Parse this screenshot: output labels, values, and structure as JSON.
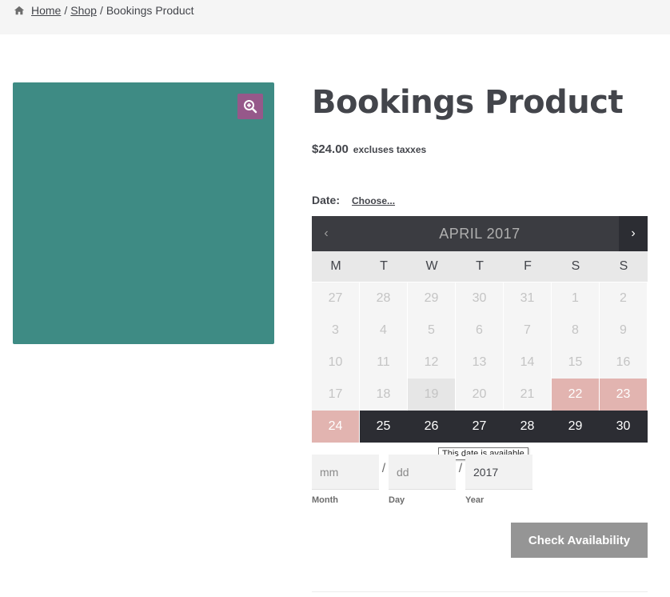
{
  "breadcrumb": {
    "home": "Home",
    "shop": "Shop",
    "separator": "/",
    "current": "Bookings Product"
  },
  "product": {
    "title": "Bookings Product",
    "price": "$24.00",
    "price_suffix": "excluses taxxes",
    "image_color": "#3e8b84"
  },
  "booking": {
    "date_label": "Date:",
    "choose_link": "Choose...",
    "calendar": {
      "prev": "‹",
      "next": "›",
      "month_title": "APRIL 2017",
      "weekdays": [
        "M",
        "T",
        "W",
        "T",
        "F",
        "S",
        "S"
      ],
      "weeks": [
        [
          {
            "d": "27",
            "s": "past"
          },
          {
            "d": "28",
            "s": "past"
          },
          {
            "d": "29",
            "s": "past"
          },
          {
            "d": "30",
            "s": "past"
          },
          {
            "d": "31",
            "s": "past"
          },
          {
            "d": "1",
            "s": "past"
          },
          {
            "d": "2",
            "s": "past"
          }
        ],
        [
          {
            "d": "3",
            "s": "past"
          },
          {
            "d": "4",
            "s": "past"
          },
          {
            "d": "5",
            "s": "past"
          },
          {
            "d": "6",
            "s": "past"
          },
          {
            "d": "7",
            "s": "past"
          },
          {
            "d": "8",
            "s": "past"
          },
          {
            "d": "9",
            "s": "past"
          }
        ],
        [
          {
            "d": "10",
            "s": "past"
          },
          {
            "d": "11",
            "s": "past"
          },
          {
            "d": "12",
            "s": "past"
          },
          {
            "d": "13",
            "s": "past"
          },
          {
            "d": "14",
            "s": "past"
          },
          {
            "d": "15",
            "s": "past"
          },
          {
            "d": "16",
            "s": "past"
          }
        ],
        [
          {
            "d": "17",
            "s": "past"
          },
          {
            "d": "18",
            "s": "past"
          },
          {
            "d": "19",
            "s": "today"
          },
          {
            "d": "20",
            "s": "past"
          },
          {
            "d": "21",
            "s": "past"
          },
          {
            "d": "22",
            "s": "partial"
          },
          {
            "d": "23",
            "s": "partial"
          }
        ],
        [
          {
            "d": "24",
            "s": "partial"
          },
          {
            "d": "25",
            "s": "available"
          },
          {
            "d": "26",
            "s": "available"
          },
          {
            "d": "27",
            "s": "available"
          },
          {
            "d": "28",
            "s": "available"
          },
          {
            "d": "29",
            "s": "available"
          },
          {
            "d": "30",
            "s": "available"
          }
        ]
      ]
    },
    "tooltip": "This date is available",
    "fields": {
      "month_placeholder": "mm",
      "day_placeholder": "dd",
      "year_value": "2017",
      "month_label": "Month",
      "day_label": "Day",
      "year_label": "Year",
      "separator": "/"
    },
    "check_button": "Check Availability"
  },
  "colors": {
    "accent": "#96588a",
    "calendar_header": "#3b3c41",
    "available": "#2c2d33",
    "partial": "#e2b4b0",
    "button": "#959595"
  }
}
